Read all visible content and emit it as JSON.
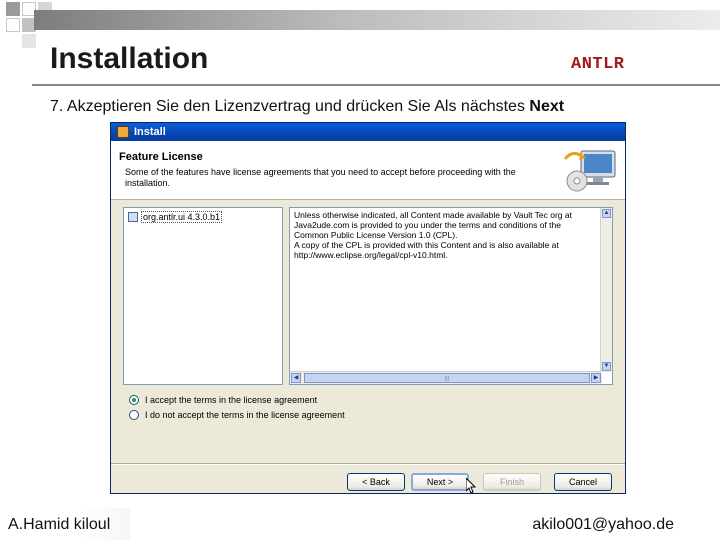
{
  "slide": {
    "title": "Installation",
    "tag": "ANTLR",
    "step": "7. Akzeptieren Sie den Lizenzvertrag und drücken Sie Als nächstes",
    "step_bold": "Next"
  },
  "dialog": {
    "title": "Install",
    "header_title": "Feature License",
    "header_desc": "Some of the features have license agreements that you need to accept before proceeding with the installation.",
    "feature_item": "org.antlr.ui 4.3.0.b1",
    "license_text": "Unless otherwise indicated, all Content made available by Vault Tec org at Java2ude.com is provided to you under the terms and conditions of the Common Public License Version 1.0 (CPL).\nA copy of the CPL is provided with this Content and is also available at http://www.eclipse.org/legal/cpl-v10.html.",
    "radio_accept": "I accept the terms in the license agreement",
    "radio_decline": "I do not accept the terms in the license agreement",
    "accept_selected": true,
    "buttons": {
      "back": "< Back",
      "next": "Next >",
      "finish": "Finish",
      "cancel": "Cancel"
    }
  },
  "footer": {
    "author": "A.Hamid kiloul",
    "email": "akilo001@yahoo.de"
  },
  "colors": {
    "tag": "#a01c1c",
    "titlebar": "#0447b5",
    "dialog_bg": "#ece9d8"
  }
}
